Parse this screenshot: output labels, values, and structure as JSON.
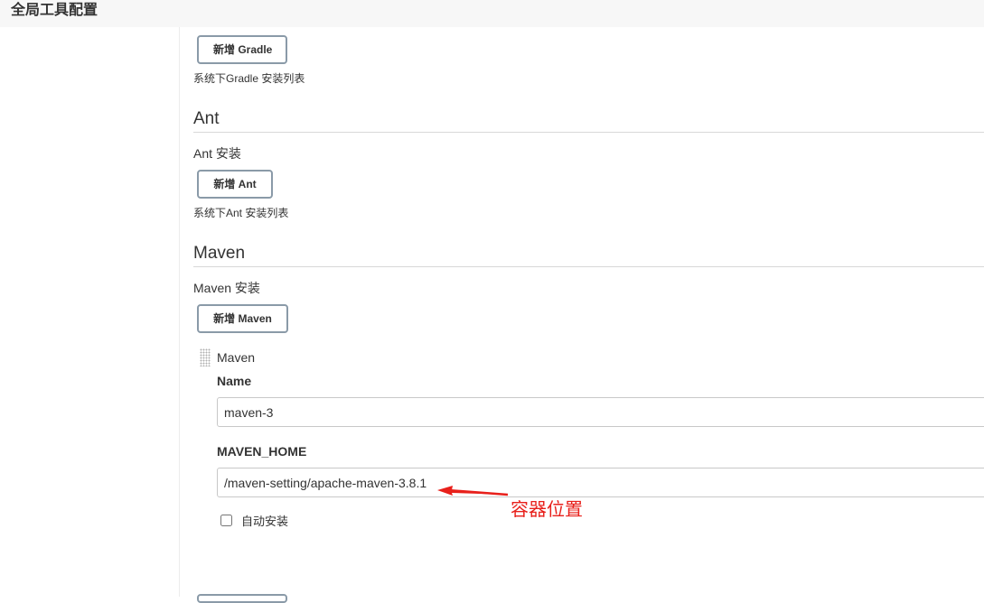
{
  "header": {
    "title": "全局工具配置"
  },
  "gradle": {
    "add_button": "新增 Gradle",
    "list_desc": "系统下Gradle 安装列表"
  },
  "ant": {
    "heading": "Ant",
    "install_label": "Ant 安装",
    "add_button": "新增 Ant",
    "list_desc": "系统下Ant 安装列表"
  },
  "maven": {
    "heading": "Maven",
    "install_label": "Maven 安装",
    "add_button": "新增 Maven",
    "item": {
      "title": "Maven",
      "name_label": "Name",
      "name_value": "maven-3",
      "home_label": "MAVEN_HOME",
      "home_value": "/maven-setting/apache-maven-3.8.1",
      "auto_install_label": "自动安装",
      "auto_install_checked": false
    }
  },
  "annotation": {
    "text": "容器位置",
    "color": "#e8201b"
  },
  "colors": {
    "button_border": "#8a9aa8",
    "topbar_bg": "#f7f7f7"
  }
}
